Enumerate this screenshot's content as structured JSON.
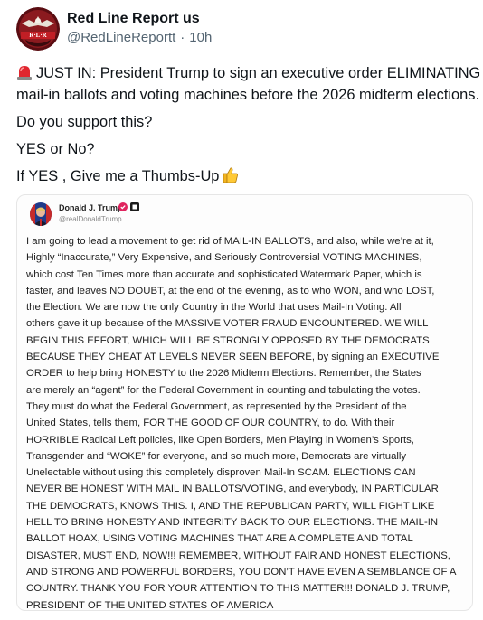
{
  "post": {
    "author_name": "Red Line Report us",
    "author_handle": "@RedLineReportt",
    "separator": "·",
    "time_ago": "10h",
    "lines": [
      "JUST IN: President Trump to sign an executive order ELIMINATING",
      "mail-in ballots and voting machines before the 2026 midterm elections.",
      "Do you support this?",
      "YES or No?",
      "If YES , Give me a Thumbs-Up"
    ],
    "icons": {
      "lead": "police-light-emoji",
      "trail": "thumbs-up-emoji"
    }
  },
  "quoted": {
    "name": "Donald J. Trump",
    "handle": "@realDonaldTrump",
    "lines": [
      "I am going to lead a movement to get rid of MAIL-IN BALLOTS, and also, while we’re at it,",
      "Highly “Inaccurate,” Very Expensive, and Seriously Controversial VOTING MACHINES,",
      "which cost Ten Times more than accurate and sophisticated Watermark Paper, which is",
      "faster, and leaves NO DOUBT, at the end of the evening, as to who WON, and who LOST,",
      "the Election. We are now the only Country in the World that uses Mail-In Voting. All",
      "others gave it up because of the MASSIVE VOTER FRAUD ENCOUNTERED. WE WILL",
      "BEGIN THIS EFFORT, WHICH WILL BE STRONGLY OPPOSED BY THE DEMOCRATS",
      "BECAUSE THEY CHEAT AT LEVELS NEVER SEEN BEFORE, by signing an EXECUTIVE",
      "ORDER to help bring HONESTY to the 2026 Midterm Elections. Remember, the States",
      "are merely an “agent” for the Federal Government in counting and tabulating the votes.",
      "They must do what the Federal Government, as represented by the President of the",
      "United States, tells them, FOR THE GOOD OF OUR COUNTRY, to do. With their",
      "HORRIBLE Radical Left policies, like Open Borders, Men Playing in Women’s Sports,",
      "Transgender and “WOKE” for everyone, and so much more, Democrats are virtually",
      "Unelectable without using this completely disproven Mail-In SCAM. ELECTIONS CAN",
      "NEVER BE HONEST WITH MAIL IN BALLOTS/VOTING, and everybody, IN PARTICULAR",
      "THE DEMOCRATS, KNOWS THIS. I, AND THE REPUBLICAN PARTY, WILL FIGHT LIKE",
      "HELL TO BRING HONESTY AND INTEGRITY BACK TO OUR ELECTIONS. THE MAIL-IN",
      "BALLOT HOAX, USING VOTING MACHINES THAT ARE A COMPLETE AND TOTAL",
      "DISASTER, MUST END, NOW!!! REMEMBER, WITHOUT FAIR AND HONEST ELECTIONS,",
      "AND STRONG AND POWERFUL BORDERS, YOU DON’T HAVE EVEN A SEMBLANCE OF A",
      "COUNTRY. THANK YOU FOR YOUR ATTENTION TO THIS MATTER!!! DONALD J. TRUMP,",
      "PRESIDENT OF THE UNITED STATES OF AMERICA"
    ]
  },
  "colors": {
    "text": "#0f1419",
    "muted": "#536471",
    "quote_border": "#e6e6e6",
    "verified": "#e0245e"
  }
}
